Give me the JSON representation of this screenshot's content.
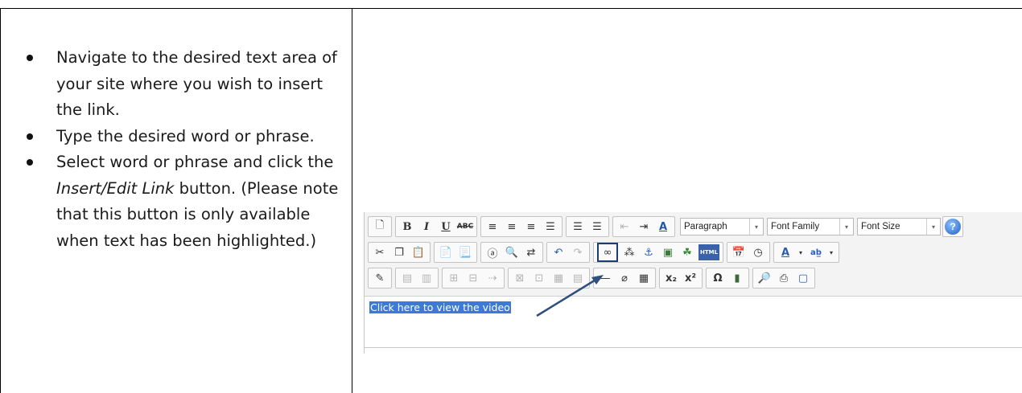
{
  "instructions": {
    "steps": [
      {
        "text": "Navigate to the desired text area of your site where you wish to insert the link."
      },
      {
        "text": "Type the desired word or phrase."
      },
      {
        "pre": "Select word or phrase and click the ",
        "em": "Insert/Edit Link",
        "post": " button. (Please note that this button is only available when text has been highlighted.)"
      }
    ]
  },
  "editor": {
    "format_select": "Paragraph",
    "font_family_select": "Font Family",
    "font_size_select": "Font Size",
    "help_label": "?",
    "html_button_label": "HTML",
    "selected_text": "Click here to view the video",
    "icons_row1": [
      "new-document-icon",
      "bold-icon",
      "italic-icon",
      "underline-icon",
      "strikethrough-icon",
      "align-left-icon",
      "align-center-icon",
      "align-right-icon",
      "align-justify-icon",
      "bullet-list-icon",
      "numbered-list-icon",
      "outdent-icon",
      "indent-icon",
      "styles-icon"
    ],
    "icons_row2": [
      "cut-icon",
      "copy-icon",
      "paste-icon",
      "paste-text-icon",
      "paste-word-icon",
      "select-all-icon",
      "find-icon",
      "replace-icon",
      "undo-icon",
      "redo-icon",
      "insert-edit-link-icon",
      "unlink-icon",
      "anchor-icon",
      "image-icon",
      "media-icon",
      "html-icon",
      "date-icon",
      "time-icon",
      "text-color-icon",
      "highlight-color-icon"
    ],
    "icons_row3": [
      "edit-properties-icon",
      "table-row-icon",
      "table-col-icon",
      "split-icon",
      "merge-icon",
      "insert-row-icon",
      "delete-col-icon",
      "cell-props-icon",
      "row-props-icon",
      "horizontal-rule-icon",
      "remove-format-icon",
      "table-icon",
      "subscript-icon",
      "superscript-icon",
      "special-char-icon",
      "media-file-icon",
      "preview-icon",
      "print-icon",
      "fullscreen-icon"
    ],
    "accent_color": "#1c3d73",
    "selection_color": "#3b7ad8"
  }
}
